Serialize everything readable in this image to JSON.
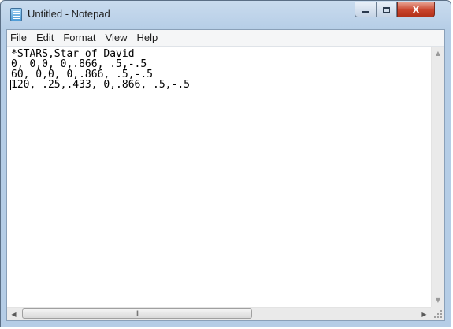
{
  "window": {
    "title": "Untitled - Notepad"
  },
  "controls": {
    "minimize_icon": "minimize-icon",
    "maximize_icon": "maximize-icon",
    "close_glyph": "X"
  },
  "menu": {
    "items": [
      {
        "label": "File"
      },
      {
        "label": "Edit"
      },
      {
        "label": "Format"
      },
      {
        "label": "View"
      },
      {
        "label": "Help"
      }
    ]
  },
  "editor": {
    "text": "*STARS,Star of David\n0, 0,0, 0,.866, .5,-.5\n60, 0,0, 0,.866, .5,-.5\n120, .25,.433, 0,.866, .5,-.5"
  },
  "scrollbar": {
    "thumb_grip": "III"
  },
  "colors": {
    "title_bar": "#c9dbee",
    "close_button": "#c8432c"
  }
}
